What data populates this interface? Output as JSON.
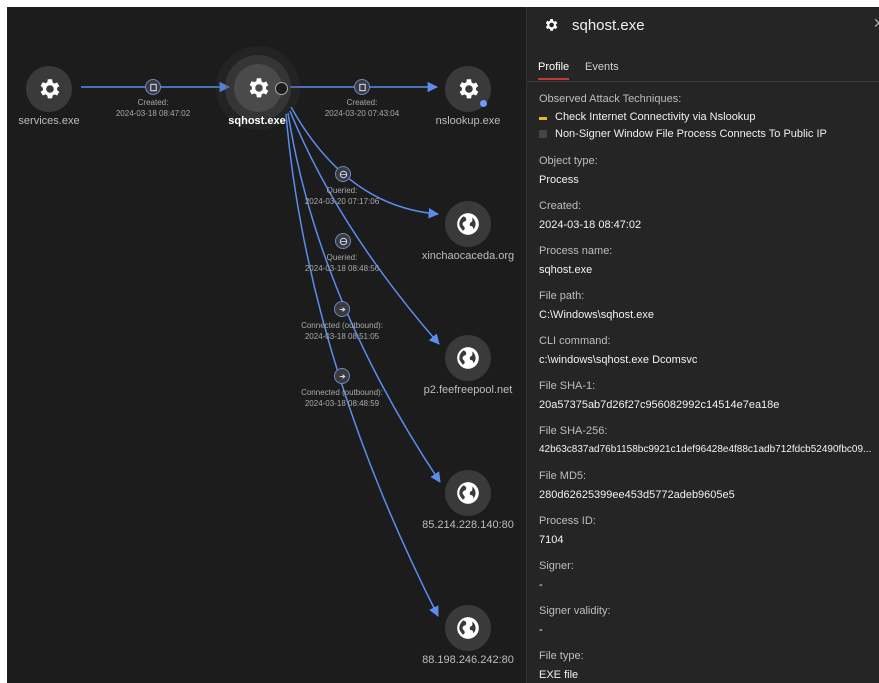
{
  "graph": {
    "nodes": {
      "services": {
        "label": "services.exe",
        "icon": "gear-icon"
      },
      "sqhost": {
        "label": "sqhost.exe",
        "icon": "gear-icon"
      },
      "nslookup": {
        "label": "nslookup.exe",
        "icon": "gear-icon"
      },
      "xinchao": {
        "label": "xinchaocaceda.org",
        "icon": "globe-icon"
      },
      "p2": {
        "label": "p2.feefreepool.net",
        "icon": "globe-icon"
      },
      "ip1": {
        "label": "85.214.228.140:80",
        "icon": "globe-icon"
      },
      "ip2": {
        "label": "88.198.246.242:80",
        "icon": "globe-icon"
      }
    },
    "edges": {
      "e1": {
        "verb": "Created:",
        "time": "2024-03-18 08:47:02"
      },
      "e2": {
        "verb": "Created:",
        "time": "2024-03-20 07:43:04"
      },
      "e3": {
        "verb": "Queried:",
        "time": "2024-03-20 07:17:06"
      },
      "e4": {
        "verb": "Queried:",
        "time": "2024-03-18 08:48:56"
      },
      "e5": {
        "verb": "Connected (outbound):",
        "time": "2024-03-18 08:51:05"
      },
      "e6": {
        "verb": "Connected (outbound):",
        "time": "2024-03-18 08:48:59"
      }
    }
  },
  "panel": {
    "title": "sqhost.exe",
    "close_glyph": "✕",
    "tabs": {
      "profile": "Profile",
      "events": "Events"
    },
    "techniques": {
      "label": "Observed Attack Techniques:",
      "items": [
        {
          "text": "Check Internet Connectivity via Nslookup",
          "color": "#e5b81f"
        },
        {
          "text": "Non-Signer Window File Process Connects To Public IP",
          "color": "#444444"
        }
      ]
    },
    "fields": {
      "object_type": {
        "label": "Object type:",
        "value": "Process"
      },
      "created": {
        "label": "Created:",
        "value": "2024-03-18 08:47:02"
      },
      "process_name": {
        "label": "Process name:",
        "value": "sqhost.exe"
      },
      "file_path": {
        "label": "File path:",
        "value": "C:\\Windows\\sqhost.exe"
      },
      "cli": {
        "label": "CLI command:",
        "value": "c:\\windows\\sqhost.exe Dcomsvc"
      },
      "sha1": {
        "label": "File SHA-1:",
        "value": "20a57375ab7d26f27c956082992c14514e7ea18e"
      },
      "sha256": {
        "label": "File SHA-256:",
        "value": "42b63c837ad76b1158bc9921c1def96428e4f88c1adb712fdcb52490fbc09..."
      },
      "md5": {
        "label": "File MD5:",
        "value": "280d62625399ee453d5772adeb9605e5"
      },
      "pid": {
        "label": "Process ID:",
        "value": "7104"
      },
      "signer": {
        "label": "Signer:",
        "value": "-"
      },
      "signer_validity": {
        "label": "Signer validity:",
        "value": "-"
      },
      "file_type": {
        "label": "File type:",
        "value": "EXE file"
      }
    }
  },
  "colors": {
    "edge": "#5b8def",
    "accent_tab": "#c2393b",
    "background": "#1c1c1c",
    "panel": "#252525"
  }
}
